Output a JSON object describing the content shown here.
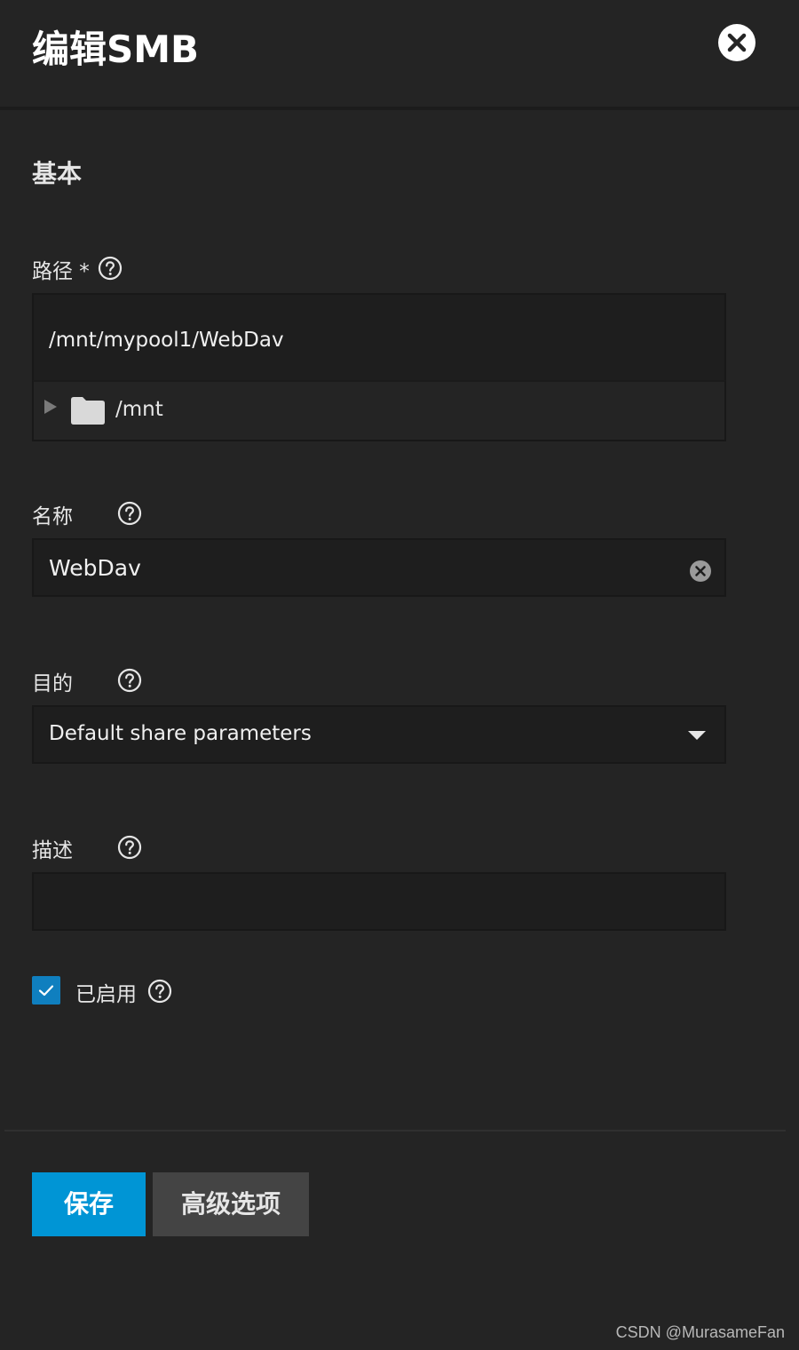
{
  "dialog": {
    "title": "编辑SMB",
    "close_icon": "close-icon"
  },
  "section": {
    "title": "基本"
  },
  "path": {
    "label": "路径 *",
    "value": "/mnt/mypool1/WebDav",
    "tree_item_label": "/mnt",
    "help_icon": "help-circle-icon"
  },
  "name": {
    "label": "名称",
    "value": "WebDav",
    "help_icon": "help-circle-icon"
  },
  "purpose": {
    "label": "目的",
    "selected": "Default share parameters",
    "help_icon": "help-circle-icon"
  },
  "description": {
    "label": "描述",
    "value": "",
    "help_icon": "help-circle-icon"
  },
  "enabled": {
    "label": "已启用",
    "checked": true,
    "help_icon": "help-circle-icon"
  },
  "buttons": {
    "save": "保存",
    "advanced": "高级选项"
  },
  "watermark": "CSDN @MurasameFan",
  "colors": {
    "background": "#242424",
    "input_bg": "#1e1e1e",
    "primary": "#0095d5",
    "secondary": "#444444",
    "checkbox": "#0f7fbf"
  }
}
